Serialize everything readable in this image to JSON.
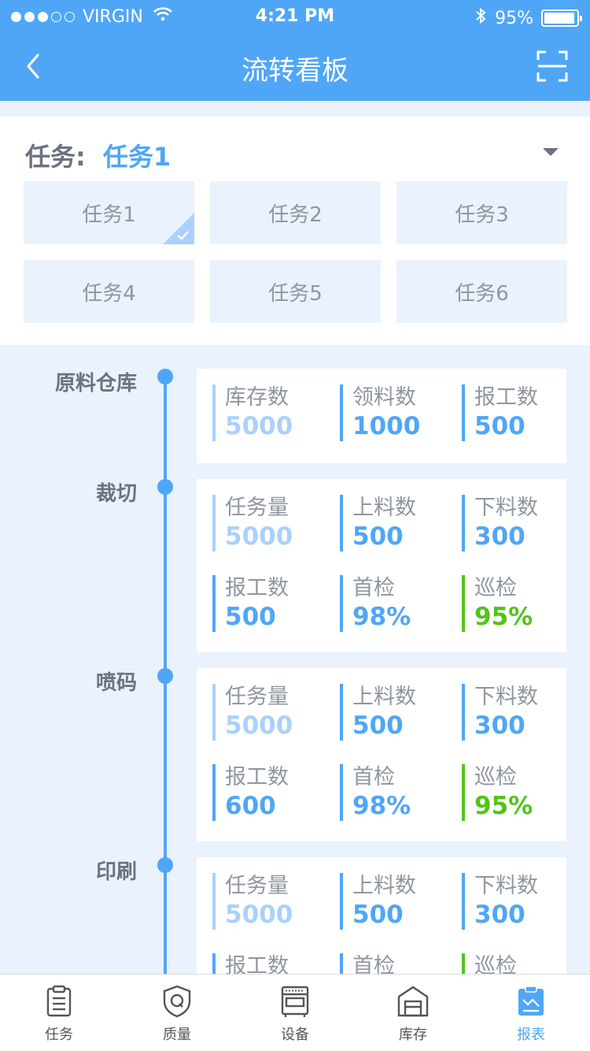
{
  "status_bar": {
    "carrier": "VIRGIN",
    "time": "4:21 PM",
    "battery": "95%",
    "battery_level": 0.95,
    "signal_dots_filled": 3,
    "signal_dots_total": 5
  },
  "nav": {
    "title": "流转看板",
    "back_icon": "chevron-left-icon",
    "scan_icon": "scan-icon"
  },
  "task_selector": {
    "label": "任务:",
    "selected": "任务1",
    "options": [
      "任务1",
      "任务2",
      "任务3",
      "任务4",
      "任务5",
      "任务6"
    ],
    "selected_index": 0
  },
  "stages": [
    {
      "name": "原料仓库",
      "metrics": [
        {
          "label": "库存数",
          "value": "5000"
        },
        {
          "label": "领料数",
          "value": "1000"
        },
        {
          "label": "报工数",
          "value": "500"
        }
      ]
    },
    {
      "name": "裁切",
      "metrics": [
        {
          "label": "任务量",
          "value": "5000"
        },
        {
          "label": "上料数",
          "value": "500"
        },
        {
          "label": "下料数",
          "value": "300"
        },
        {
          "label": "报工数",
          "value": "500"
        },
        {
          "label": "首检",
          "value": "98%"
        },
        {
          "label": "巡检",
          "value": "95%"
        }
      ]
    },
    {
      "name": "喷码",
      "metrics": [
        {
          "label": "任务量",
          "value": "5000"
        },
        {
          "label": "上料数",
          "value": "500"
        },
        {
          "label": "下料数",
          "value": "300"
        },
        {
          "label": "报工数",
          "value": "600"
        },
        {
          "label": "首检",
          "value": "98%"
        },
        {
          "label": "巡检",
          "value": "95%"
        }
      ]
    },
    {
      "name": "印刷",
      "metrics": [
        {
          "label": "任务量",
          "value": "5000"
        },
        {
          "label": "上料数",
          "value": "500"
        },
        {
          "label": "下料数",
          "value": "300"
        },
        {
          "label": "报工数",
          "value": ""
        },
        {
          "label": "首检",
          "value": ""
        },
        {
          "label": "巡检",
          "value": ""
        }
      ]
    }
  ],
  "tabs": [
    {
      "label": "任务",
      "icon": "clipboard-icon"
    },
    {
      "label": "质量",
      "icon": "shield-q-icon"
    },
    {
      "label": "设备",
      "icon": "machine-icon"
    },
    {
      "label": "库存",
      "icon": "warehouse-icon"
    },
    {
      "label": "报表",
      "icon": "report-icon"
    }
  ],
  "active_tab": 4,
  "colors": {
    "primary": "#4fa6f7",
    "light_blue": "#a9d1fb",
    "green": "#52c41a",
    "background": "#e9f2fd",
    "text_gray": "#8f96a0"
  }
}
